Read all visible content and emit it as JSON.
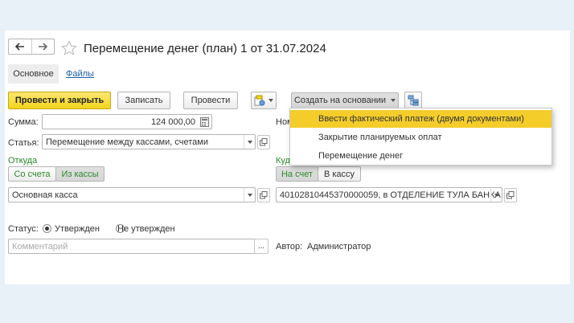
{
  "window": {
    "title": "Перемещение денег (план) 1 от 31.07.2024"
  },
  "tabs": [
    {
      "label": "Основное",
      "active": true
    },
    {
      "label": "Файлы",
      "active": false
    }
  ],
  "toolbar": {
    "post_close_label": "Провести и закрыть",
    "save_label": "Записать",
    "post_label": "Провести",
    "create_based_label": "Создать на основании"
  },
  "create_menu": {
    "items": [
      {
        "label": "Ввести фактический платеж (двумя документами)",
        "highlighted": true
      },
      {
        "label": "Закрытие планируемых оплат",
        "highlighted": false
      },
      {
        "label": "Перемещение денег",
        "highlighted": false
      }
    ]
  },
  "form": {
    "amount_label": "Сумма:",
    "amount_value": "124 000,00",
    "number_label_partial": "Ном",
    "article_label": "Статья:",
    "article_value": "Перемещение между кассами, счетами",
    "from_label": "Откуда",
    "from_toggle": [
      {
        "label": "Со счета",
        "active": false
      },
      {
        "label": "Из кассы",
        "active": true
      }
    ],
    "from_value": "Основная касса",
    "to_label_partial": "Куд",
    "to_toggle": [
      {
        "label": "На счет",
        "active": true
      },
      {
        "label": "В кассу",
        "active": false
      }
    ],
    "to_value": "40102810445370000059, в ОТДЕЛЕНИЕ ТУЛА БАНКА",
    "status_label": "Статус:",
    "status_options": [
      {
        "label": "Утвержден",
        "selected": true
      },
      {
        "label": "Не утвержден",
        "selected": false
      }
    ],
    "comment_placeholder": "Комментарий",
    "comment_more": "...",
    "author_label": "Автор:",
    "author_value": "Администратор"
  },
  "colors": {
    "accent_yellow": "#f3d41c",
    "link_blue": "#1a5fa8",
    "group_green": "#2a8a2a",
    "menu_highlight": "#f4cd2b"
  }
}
